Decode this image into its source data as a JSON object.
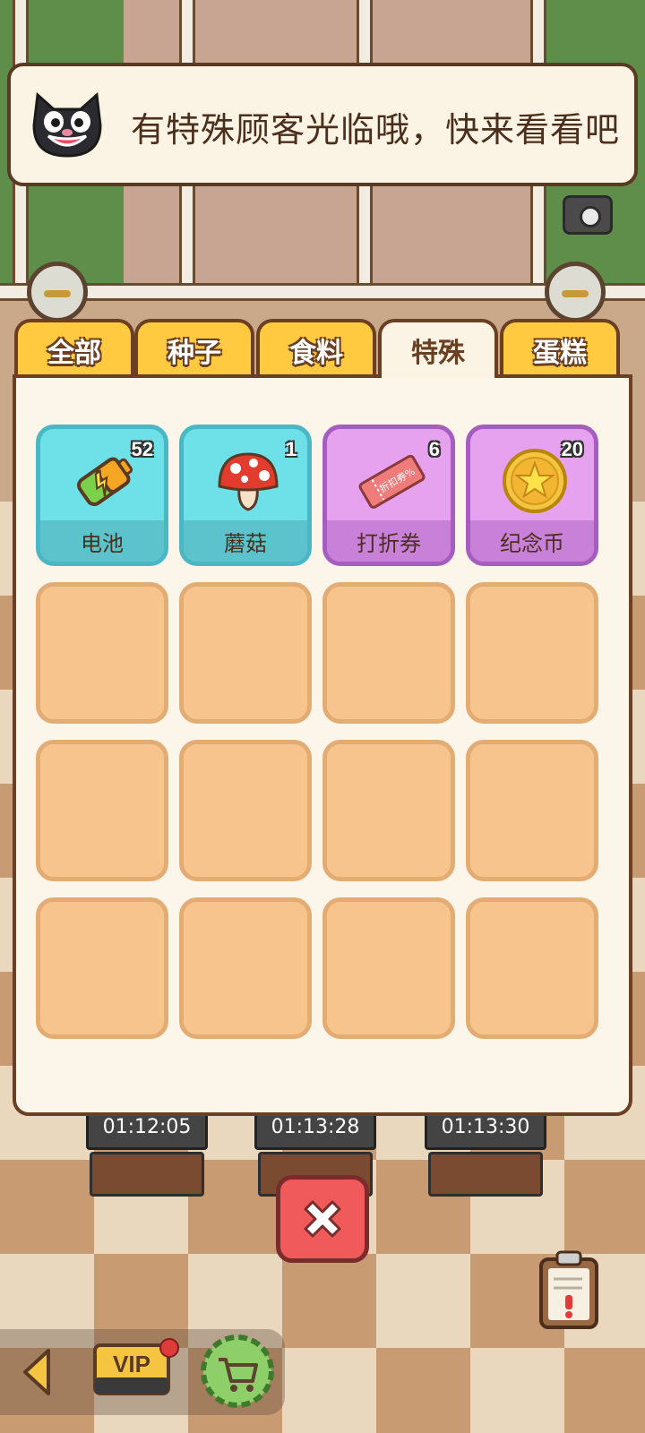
{
  "notice": {
    "message": "有特殊顾客光临哦，快来看看吧"
  },
  "tabs": [
    {
      "label": "全部",
      "active": false
    },
    {
      "label": "种子",
      "active": false
    },
    {
      "label": "食料",
      "active": false
    },
    {
      "label": "特殊",
      "active": true
    },
    {
      "label": "蛋糕",
      "active": false
    }
  ],
  "items": [
    {
      "name": "电池",
      "count": "52",
      "icon": "battery-icon",
      "color": "blue"
    },
    {
      "name": "蘑菇",
      "count": "1",
      "icon": "mushroom-icon",
      "color": "blue"
    },
    {
      "name": "打折券",
      "count": "6",
      "icon": "discount-coupon-icon",
      "color": "purple",
      "coupon_text": "折扣券%"
    },
    {
      "name": "纪念币",
      "count": "20",
      "icon": "commemorative-coin-icon",
      "color": "purple"
    }
  ],
  "timers": [
    "01:12:05",
    "01:13:28",
    "01:13:30"
  ],
  "bottom_bar": {
    "vip_label": "VIP"
  },
  "colors": {
    "tab_yellow": "#ffca3f",
    "panel_bg": "#fcf6ea",
    "slot_empty": "#f8c48d",
    "slot_blue": "#6de0e8",
    "slot_purple": "#e6a2ef",
    "close_red": "#f15a5a",
    "outline_brown": "#6b3f22"
  }
}
